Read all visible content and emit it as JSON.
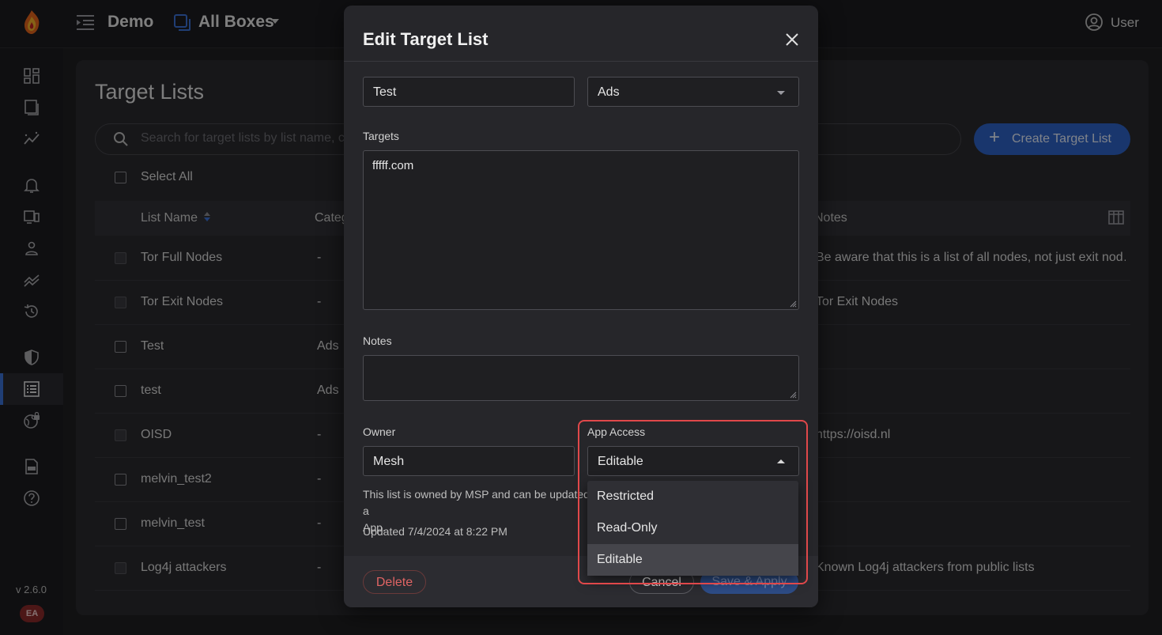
{
  "topbar": {
    "org_name": "Demo",
    "boxes_label": "All Boxes",
    "user_label": "User"
  },
  "sidebar": {
    "items": [
      {
        "icon": "dashboard-icon"
      },
      {
        "icon": "devices-icon"
      },
      {
        "icon": "insights-icon"
      },
      {
        "icon": "bell-icon"
      },
      {
        "icon": "boxes-icon"
      },
      {
        "icon": "person-icon"
      },
      {
        "icon": "trend-icon"
      },
      {
        "icon": "history-icon"
      },
      {
        "icon": "shield-icon"
      },
      {
        "icon": "target-list-icon",
        "active": true
      },
      {
        "icon": "globe-lock-icon"
      },
      {
        "icon": "api-doc-icon"
      },
      {
        "icon": "help-icon"
      }
    ],
    "version": "v 2.6.0",
    "badge": "EA",
    "accent": "#3b72d6"
  },
  "page": {
    "title": "Target Lists",
    "search_placeholder": "Search for target lists by list name, c",
    "create_button": "Create Target List",
    "select_all": "Select All",
    "columns": {
      "name": "List Name",
      "category": "Categ",
      "notes": "Notes"
    },
    "rows": [
      {
        "name": "Tor Full Nodes",
        "category": "-",
        "notes": "Be aware that this is a list of all nodes, not just exit nod…",
        "disabled": true
      },
      {
        "name": "Tor Exit Nodes",
        "category": "-",
        "notes": "Tor Exit Nodes",
        "disabled": true
      },
      {
        "name": "Test",
        "category": "Ads",
        "notes": "",
        "disabled": false
      },
      {
        "name": "test",
        "category": "Ads",
        "notes": "",
        "disabled": false
      },
      {
        "name": "OISD",
        "category": "-",
        "notes": "https://oisd.nl",
        "disabled": true
      },
      {
        "name": "melvin_test2",
        "category": "-",
        "notes": "",
        "disabled": false
      },
      {
        "name": "melvin_test",
        "category": "-",
        "notes": "",
        "disabled": false
      },
      {
        "name": "Log4j attackers",
        "category": "-",
        "notes": "Known Log4j attackers from public lists",
        "disabled": true
      }
    ]
  },
  "modal": {
    "title": "Edit Target List",
    "name_value": "Test",
    "category_value": "Ads",
    "targets_label": "Targets",
    "targets_value": "fffff.com",
    "notes_label": "Notes",
    "notes_value": "",
    "owner_label": "Owner",
    "owner_value": "Mesh",
    "access_label": "App Access",
    "access_value": "Editable",
    "helper_text": "This list is owned by MSP and can be updated a App.",
    "helper_line1": "This list is owned by MSP and can be updated a",
    "helper_line2": "App.",
    "updated_text": "Updated 7/4/2024 at 8:22 PM",
    "delete_button": "Delete",
    "cancel_button": "Cancel",
    "save_button": "Save & Apply",
    "access_options": [
      "Restricted",
      "Read-Only",
      "Editable"
    ],
    "highlight_color": "#e0484a"
  }
}
